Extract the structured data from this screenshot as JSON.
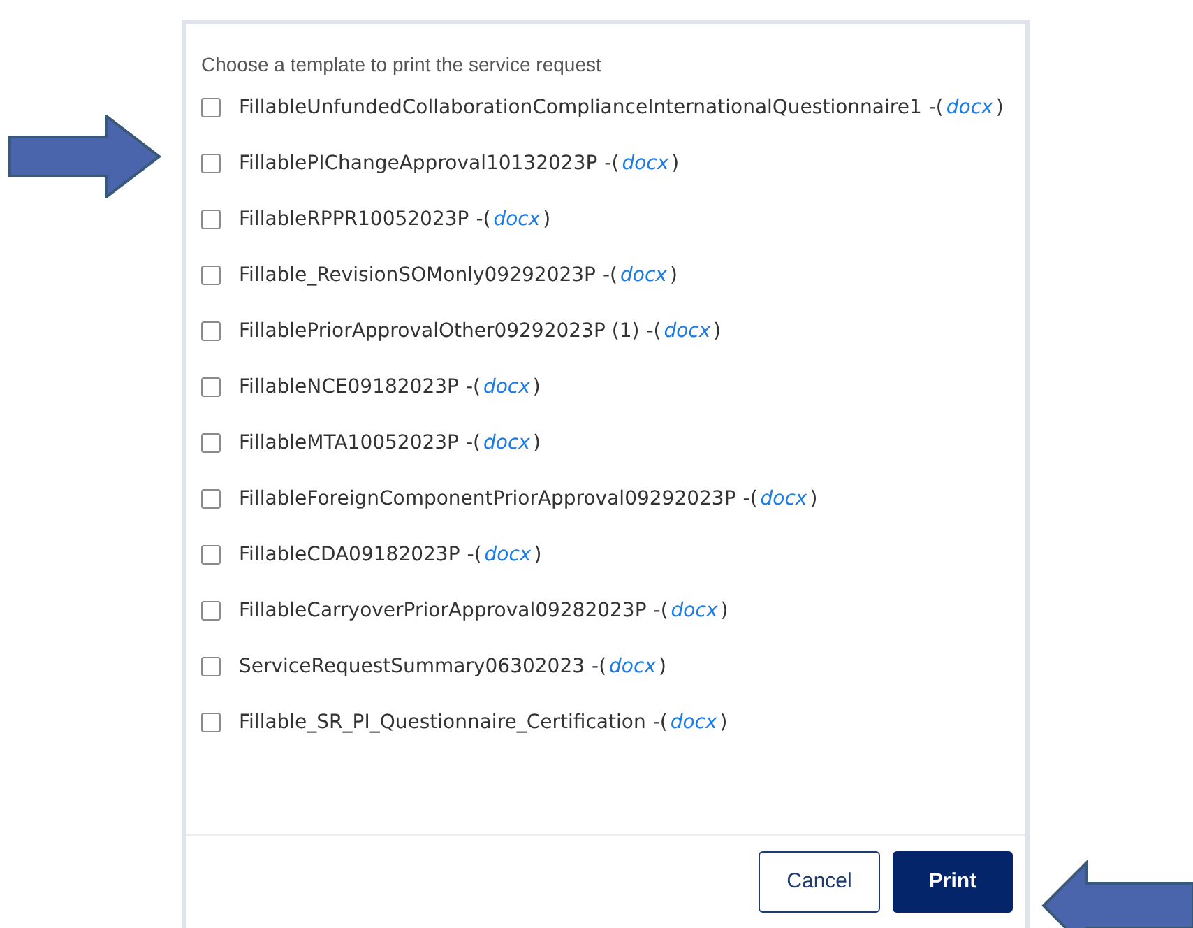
{
  "dialog": {
    "instruction": "Choose a template to print the service request",
    "templates": [
      {
        "name": "FillableUnfundedCollaborationComplianceInternationalQuestionnaire1",
        "open": "-(",
        "link": "docx",
        "close": ")",
        "checked": false
      },
      {
        "name": "FillablePIChangeApproval10132023P",
        "open": "-(",
        "link": "docx",
        "close": ")",
        "checked": false
      },
      {
        "name": "FillableRPPR10052023P",
        "open": "-(",
        "link": "docx",
        "close": ")",
        "checked": false
      },
      {
        "name": "Fillable_RevisionSOMonly09292023P",
        "open": "-(",
        "link": "docx",
        "close": ")",
        "checked": false
      },
      {
        "name": "FillablePriorApprovalOther09292023P (1)",
        "open": "-(",
        "link": "docx",
        "close": ")",
        "checked": false
      },
      {
        "name": "FillableNCE09182023P",
        "open": "-(",
        "link": "docx",
        "close": ")",
        "checked": false
      },
      {
        "name": "FillableMTA10052023P",
        "open": "-(",
        "link": "docx",
        "close": ")",
        "checked": false
      },
      {
        "name": "FillableForeignComponentPriorApproval09292023P",
        "open": "-(",
        "link": "docx",
        "close": ")",
        "checked": false
      },
      {
        "name": "FillableCDA09182023P",
        "open": "-(",
        "link": "docx",
        "close": ")",
        "checked": false
      },
      {
        "name": "FillableCarryoverPriorApproval09282023P",
        "open": "-(",
        "link": "docx",
        "close": ")",
        "checked": false
      },
      {
        "name": "ServiceRequestSummary06302023",
        "open": "-(",
        "link": "docx",
        "close": ")",
        "checked": false
      },
      {
        "name": "Fillable_SR_PI_Questionnaire_Certification",
        "open": "-(",
        "link": "docx",
        "close": ")",
        "checked": false
      }
    ],
    "buttons": [
      {
        "label": "Cancel",
        "kind": "secondary"
      },
      {
        "label": "Print",
        "kind": "primary"
      }
    ]
  }
}
